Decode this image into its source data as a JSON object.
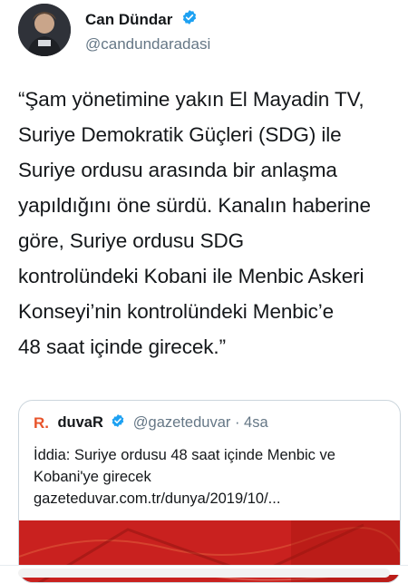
{
  "tweet": {
    "author_name": "Can Dündar",
    "author_handle": "@candundaradasi",
    "text": "“Şam yönetimine yakın El Mayadin TV,\nSuriye Demokratik Güçleri (SDG) ile\nSuriye ordusu arasında bir anlaşma\nyapıldığını öne sürdü. Kanalın haberine\ngöre, Suriye ordusu SDG\nkontrolündeki Kobani ile Menbic Askeri\nKonseyi’nin kontrolündeki Menbic’e\n48 saat içinde girecek.”"
  },
  "quote": {
    "logo_text": "R.",
    "name": "duvaR",
    "handle_time": "@gazeteduvar · 4sa",
    "text": "İddia: Suriye ordusu 48 saat içinde Menbic ve\nKobani'ye girecek\ngazeteduvar.com.tr/dunya/2019/10/..."
  },
  "colors": {
    "verified": "#1da1f2",
    "duvar_logo": "#e8542b",
    "image_red": "#c9211f"
  },
  "icons": {
    "verified": "verified-badge-icon"
  }
}
